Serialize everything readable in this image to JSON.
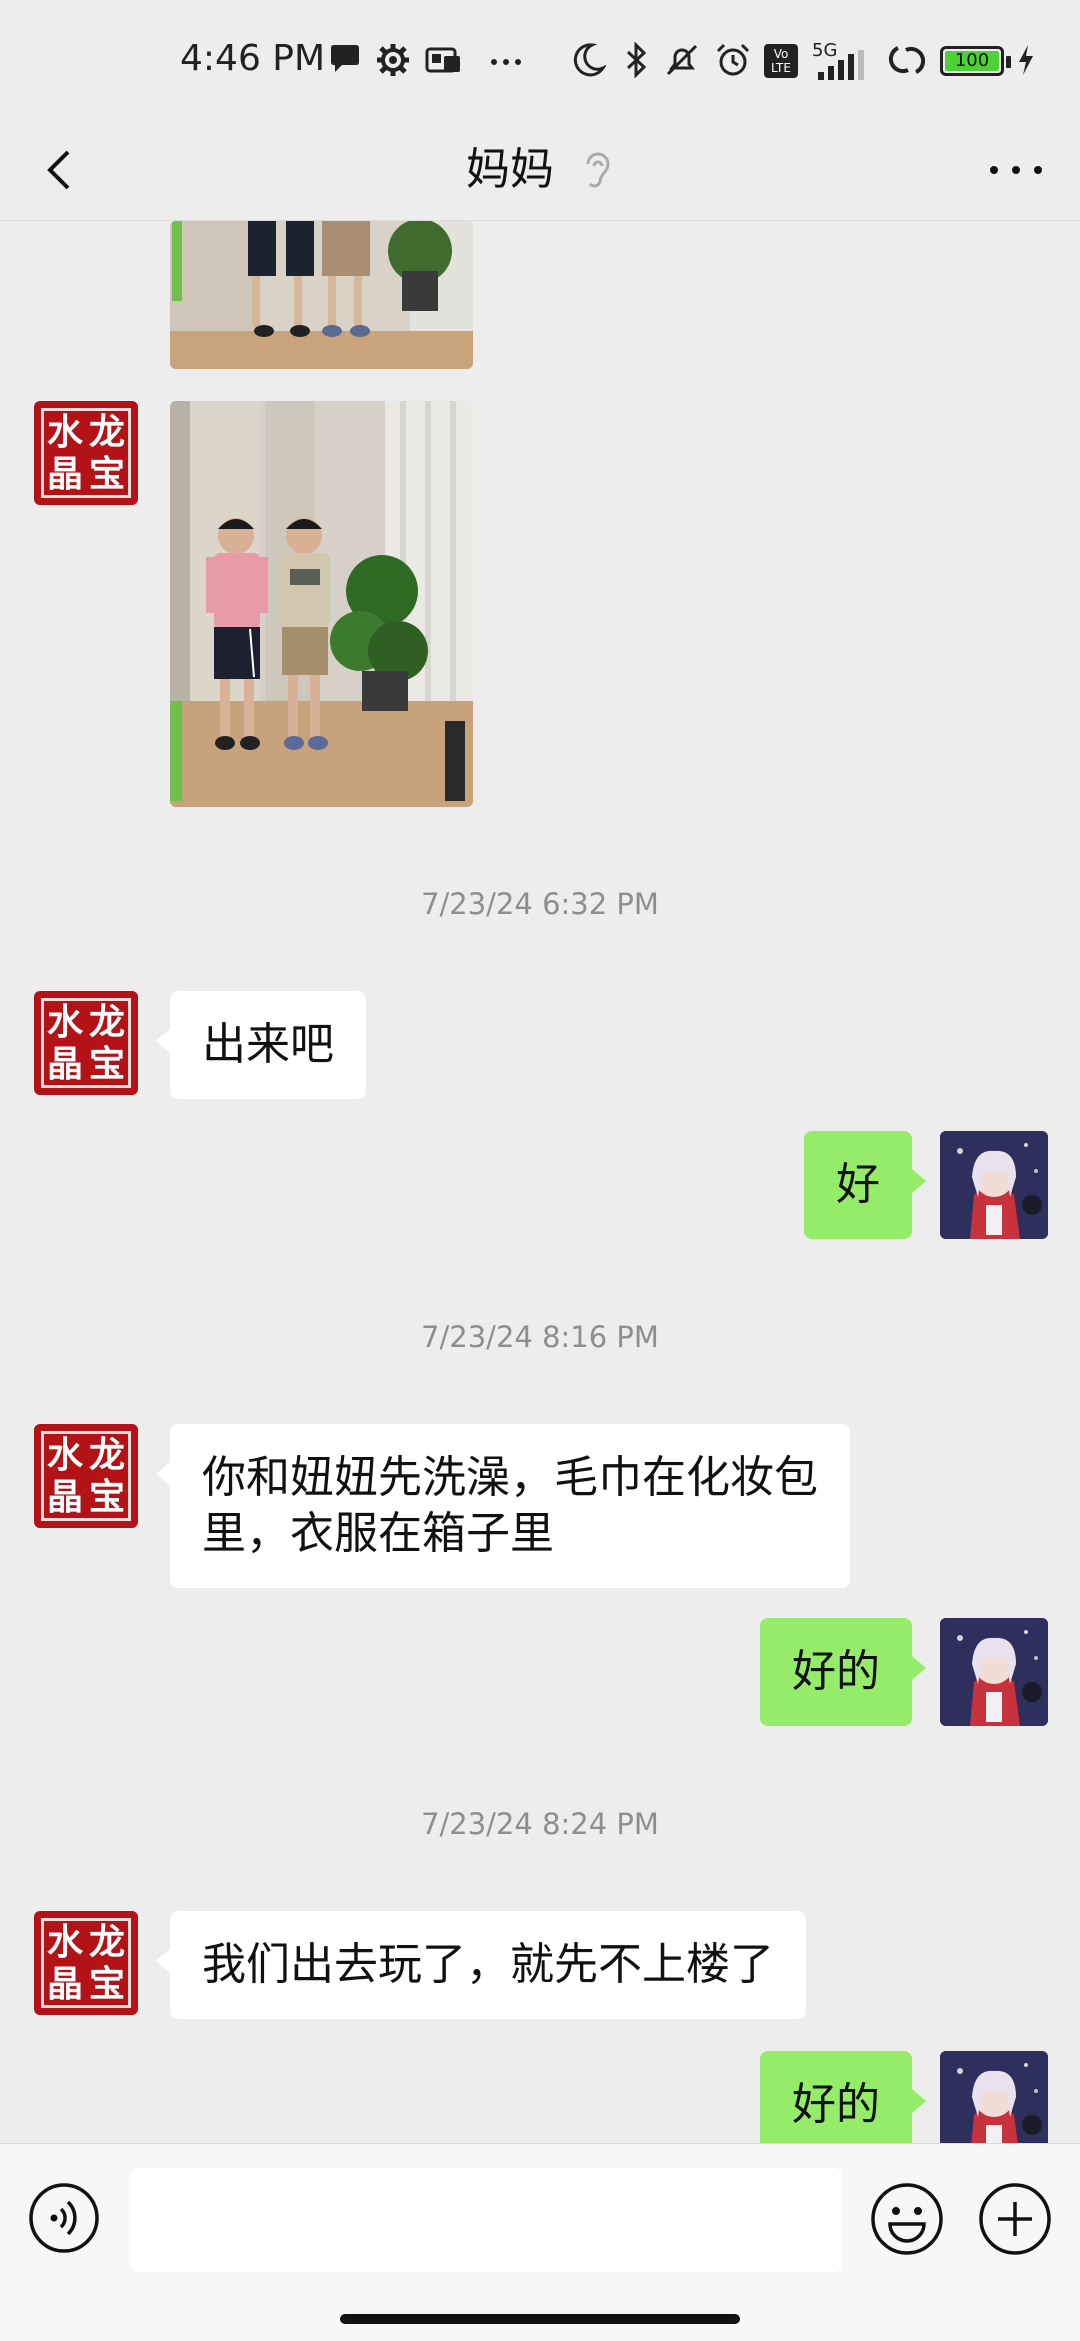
{
  "status_bar": {
    "time": "4:46 PM",
    "network": "5G",
    "volte": "Vo LTE",
    "battery": "100",
    "icons": [
      "chat-bubble-icon",
      "gear-icon",
      "sim-icon",
      "more-dots-icon",
      "moon-icon",
      "bluetooth-icon",
      "bell-off-icon",
      "alarm-icon",
      "volte-icon",
      "signal-icon",
      "hotspot-icon",
      "battery-icon",
      "charging-icon"
    ]
  },
  "header": {
    "title": "妈妈",
    "back_icon": "back-chevron-icon",
    "ear_icon": "ear-icon",
    "more_icon": "more-icon"
  },
  "contact_avatar": {
    "chars": [
      "水",
      "龙",
      "晶",
      "宝"
    ],
    "color": "#b31217"
  },
  "messages": [
    {
      "type": "image",
      "side": "left",
      "content": "photo-two-boys-cropped"
    },
    {
      "type": "image",
      "side": "left",
      "content": "photo-two-boys"
    },
    {
      "type": "timestamp",
      "text": "7/23/24 6:32 PM"
    },
    {
      "type": "text",
      "side": "left",
      "text": "出来吧"
    },
    {
      "type": "text",
      "side": "right",
      "text": "好"
    },
    {
      "type": "timestamp",
      "text": "7/23/24 8:16 PM"
    },
    {
      "type": "text",
      "side": "left",
      "line1": "你和妞妞先洗澡，毛巾在化妆包",
      "line2": "里，衣服在箱子里"
    },
    {
      "type": "text",
      "side": "right",
      "text": "好的"
    },
    {
      "type": "timestamp",
      "text": "7/23/24 8:24 PM"
    },
    {
      "type": "text",
      "side": "left",
      "text": "我们出去玩了，就先不上楼了"
    },
    {
      "type": "text",
      "side": "right",
      "text": "好的"
    }
  ],
  "input_bar": {
    "value": "",
    "voice_icon": "voice-icon",
    "emoji_icon": "emoji-icon",
    "plus_icon": "plus-icon"
  },
  "colors": {
    "background": "#ededed",
    "bubble_right": "#95ec69",
    "bubble_left": "#ffffff",
    "timestamp": "#8e8e8e"
  }
}
